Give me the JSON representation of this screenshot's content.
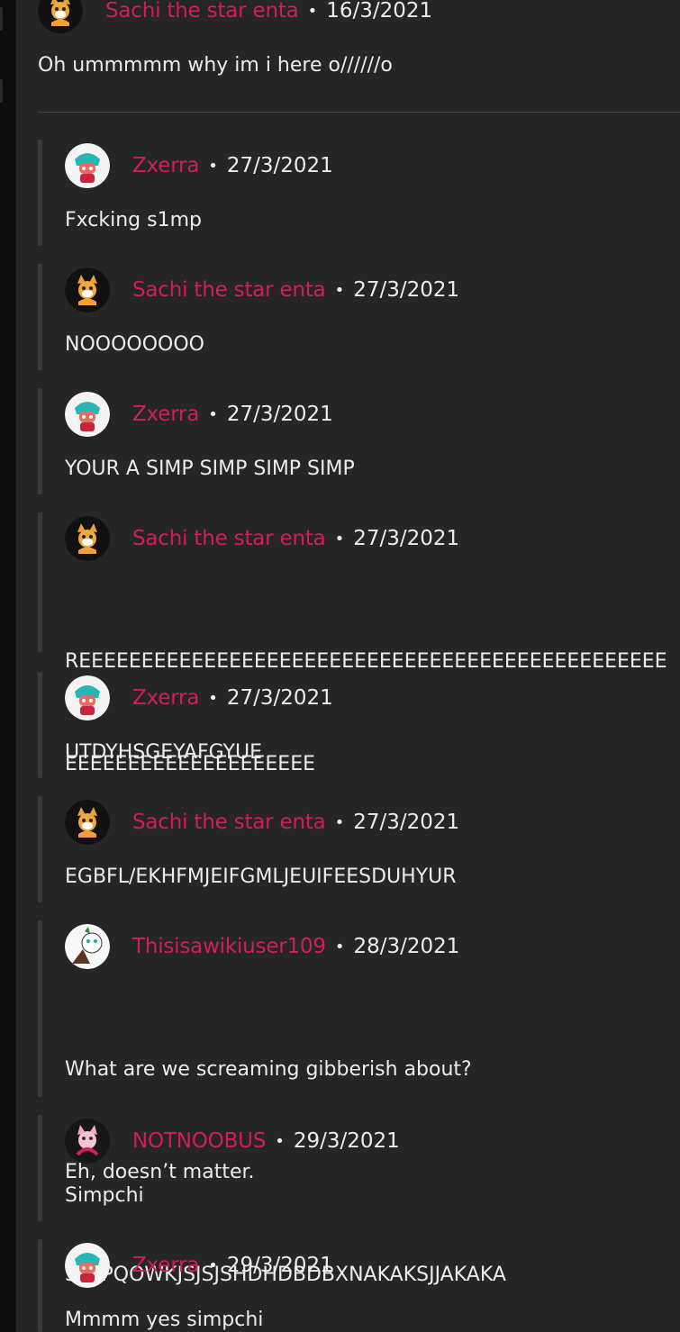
{
  "top_comment": {
    "author": "Sachi the star enta",
    "separator": "•",
    "date": "16/3/2021",
    "text": "Oh ummmmm why im i here o//////o",
    "avatar": "fox-avatar"
  },
  "replies": [
    {
      "author": "Zxerra",
      "separator": "•",
      "date": "27/3/2021",
      "text": "Fxcking s1mp",
      "avatar": "teal-character-avatar"
    },
    {
      "author": "Sachi the star enta",
      "separator": "•",
      "date": "27/3/2021",
      "text": "NOOOOOOOO",
      "avatar": "fox-avatar"
    },
    {
      "author": "Zxerra",
      "separator": "•",
      "date": "27/3/2021",
      "text": "YOUR A SIMP SIMP SIMP SIMP",
      "avatar": "teal-character-avatar"
    },
    {
      "author": "Sachi the star enta",
      "separator": "•",
      "date": "27/3/2021",
      "text_lines": [
        "REEEEEEEEEEEEEEEEEEEEEEEEEEEEEEEEEEEEEEEEEEEEEEE",
        "EEEEEEEEEEEEEEEEEEEE"
      ],
      "avatar": "fox-avatar"
    },
    {
      "author": "Zxerra",
      "separator": "•",
      "date": "27/3/2021",
      "text": "UTDYHSGEYAFGYUE",
      "avatar": "teal-character-avatar"
    },
    {
      "author": "Sachi the star enta",
      "separator": "•",
      "date": "27/3/2021",
      "text": "EGBFL/EKHFMJEIFGMLJEUIFEESDUHYUR",
      "avatar": "fox-avatar"
    },
    {
      "author": "Thisisawikiuser109",
      "separator": "•",
      "date": "28/3/2021",
      "text_lines": [
        "What are we screaming gibberish about?",
        "Eh, doesn’t matter.",
        "SPPPQOWKJSJSJSHDHDBDBXNAKAKSJJAKAKA"
      ],
      "avatar": "white-character-avatar"
    },
    {
      "author": "NOTNOOBUS",
      "separator": "•",
      "date": "29/3/2021",
      "text": "Simpchi",
      "avatar": "pink-fox-avatar"
    },
    {
      "author": "Zxerra",
      "separator": "•",
      "date": "29/3/2021",
      "text": "Mmmm yes simpchi",
      "avatar": "teal-character-avatar"
    }
  ],
  "colors": {
    "background": "#262626",
    "author": "#cf1f56",
    "text": "#ececec",
    "rail": "#0d0d0d",
    "thread_bar": "#3a3a3a"
  }
}
